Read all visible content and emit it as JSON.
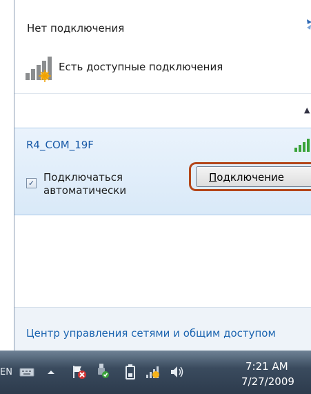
{
  "header": {
    "status_title": "Нет подключения",
    "available_label": "Есть доступные подключения",
    "refresh_icon": "refresh-network-icon",
    "collapse_icon": "chevron-up-icon"
  },
  "network": {
    "ssid": "R4_COM_19F",
    "auto_connect_checked": true,
    "auto_connect_label_line1": "Подключаться",
    "auto_connect_label_line2": "автоматически",
    "connect_button_first": "П",
    "connect_button_rest": "одключение",
    "signal_icon": "wifi-signal-icon"
  },
  "footer": {
    "link": "Центр управления сетями и общим доступом"
  },
  "taskbar": {
    "language": "EN",
    "tray_icons": [
      "keyboard-icon",
      "show-hidden-icons-arrow",
      "action-center-flag-icon",
      "usb-safely-remove-icon",
      "battery-icon",
      "network-status-icon",
      "volume-icon"
    ],
    "time": "7:21 AM",
    "date": "7/27/2009"
  },
  "colors": {
    "highlight": "#b4461a",
    "link": "#1b64b0",
    "ssid": "#1a5ba8"
  }
}
